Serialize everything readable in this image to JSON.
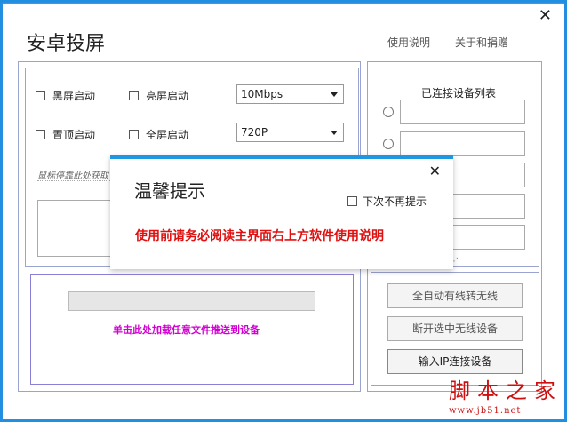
{
  "window": {
    "title": "安卓投屏",
    "close_glyph": "✕",
    "links": {
      "help": "使用说明",
      "about": "关于和捐赠"
    }
  },
  "options": {
    "black_screen": "黑屏启动",
    "bright_screen": "亮屏启动",
    "on_top": "置顶启动",
    "fullscreen": "全屏启动",
    "bitrate": "10Mbps",
    "resolution": "720P"
  },
  "hint_text": "鼠标停靠此处获取",
  "push": {
    "label": "单击此处加载任意文件推送到设备",
    "progress": 0
  },
  "devices": {
    "title": "已连接设备列表",
    "buttons": {
      "auto_wireless": "全自动有线转无线",
      "disconnect": "断开选中无线设备",
      "ip_connect": "输入IP连接设备"
    }
  },
  "dialog": {
    "title": "温馨提示",
    "close_glyph": "✕",
    "dont_show": "下次不再提示",
    "message": "使用前请务必阅读主界面右上方软件使用说明"
  },
  "watermark": {
    "text": "脚本之家",
    "url": "www.jb51.net"
  },
  "colors": {
    "accent": "#1c97e0",
    "warning": "#e01010",
    "push_link": "#d000d0"
  }
}
